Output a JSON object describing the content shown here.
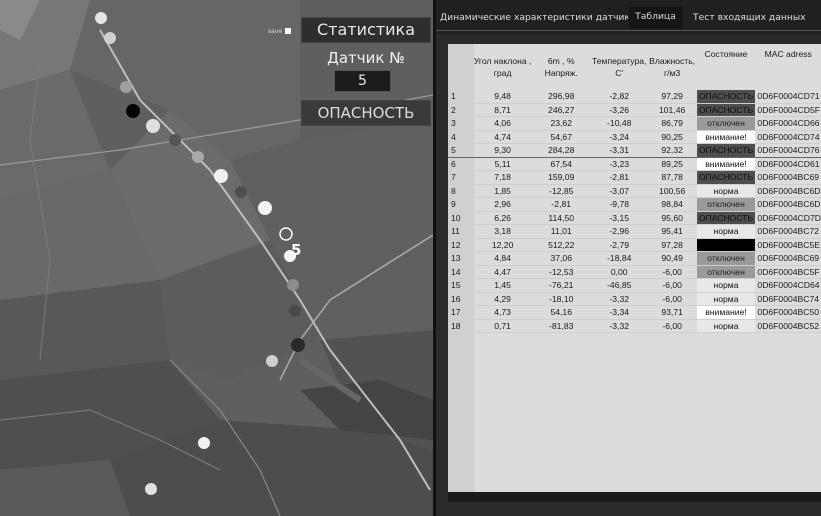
{
  "map": {
    "save_label": "save",
    "stat_button": "Статистика",
    "sensor_label": "Датчик №",
    "sensor_number": "5",
    "status_button": "ОПАСНОСТЬ",
    "selected_sensor_marker": "5"
  },
  "tabs": [
    {
      "label": "Динамические характеристики датчика"
    },
    {
      "label": "Таблица"
    },
    {
      "label": "Тест входящих данных"
    }
  ],
  "table": {
    "headers": [
      "",
      "Угол наклона , град",
      "6m , % Напряж.",
      "Температура, C'",
      "Влажность, г/м3",
      "Состояние",
      "MAC adress"
    ],
    "rows": [
      [
        "1",
        "9,48",
        "296,98",
        "-2,82",
        "97,29",
        "ОПАСНОСТЬ",
        "0D6F0004CD71"
      ],
      [
        "2",
        "8,71",
        "246,27",
        "-3,26",
        "101,46",
        "ОПАСНОСТЬ",
        "0D6F0004CD5F"
      ],
      [
        "3",
        "4,06",
        "23,62",
        "-10,48",
        "86,79",
        "отключен",
        "0D6F0004CD66"
      ],
      [
        "4",
        "4,74",
        "54,67",
        "-3,24",
        "90,25",
        "внимание!",
        "0D6F0004CD74"
      ],
      [
        "5",
        "9,30",
        "284,28",
        "-3,31",
        "92,32",
        "ОПАСНОСТЬ",
        "0D6F0004CD76"
      ],
      [
        "6",
        "5,11",
        "67,54",
        "-3,23",
        "89,25",
        "внимание!",
        "0D6F0004CD61"
      ],
      [
        "7",
        "7,18",
        "159,09",
        "-2,81",
        "87,78",
        "ОПАСНОСТЬ",
        "0D6F0004BC69"
      ],
      [
        "8",
        "1,85",
        "-12,85",
        "-3,07",
        "100,56",
        "норма",
        "0D6F0004BC6D"
      ],
      [
        "9",
        "2,96",
        "-2,81",
        "-9,78",
        "98,84",
        "отключен",
        "0D6F0004BC6D"
      ],
      [
        "10",
        "6,26",
        "114,50",
        "-3,15",
        "95,60",
        "ОПАСНОСТЬ",
        "0D6F0004CD7D"
      ],
      [
        "11",
        "3,18",
        "11,01",
        "-2,96",
        "95,41",
        "норма",
        "0D6F0004BC72"
      ],
      [
        "12",
        "12,20",
        "512,22",
        "-2,79",
        "97,28",
        "",
        "0D6F0004BC5E"
      ],
      [
        "13",
        "4,84",
        "37,06",
        "-18,84",
        "90,49",
        "отключен",
        "0D6F0004BC69"
      ],
      [
        "14",
        "4,47",
        "-12,53",
        "0,00",
        "-6,00",
        "отключен",
        "0D6F0004BC5F"
      ],
      [
        "15",
        "1,45",
        "-76,21",
        "-46,85",
        "-6,00",
        "норма",
        "0D6F0004CD64"
      ],
      [
        "16",
        "4,29",
        "-18,10",
        "-3,32",
        "-6,00",
        "норма",
        "0D6F0004BC74"
      ],
      [
        "17",
        "4,73",
        "54,16",
        "-3,34",
        "93,71",
        "внимание!",
        "0D6F0004BC50"
      ],
      [
        "18",
        "0,71",
        "-81,83",
        "-3,32",
        "-6,00",
        "норма",
        "0D6F0004BC52"
      ]
    ],
    "selected_row": 5
  }
}
